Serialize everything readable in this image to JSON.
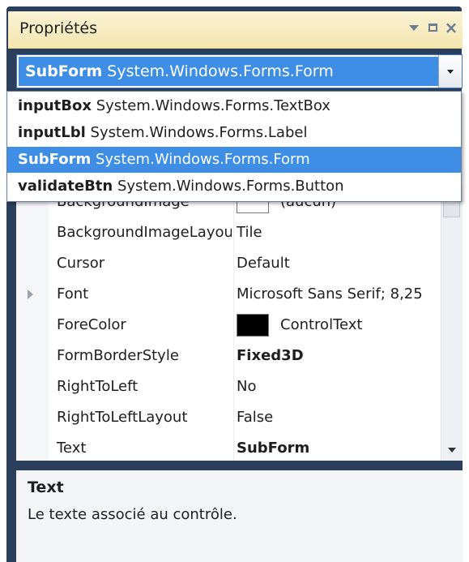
{
  "panel": {
    "title": "Propriétés",
    "icons": [
      "dropdown-triangle-icon",
      "maximize-icon",
      "close-icon"
    ]
  },
  "selector": {
    "name": "SubForm",
    "type": "System.Windows.Forms.Form"
  },
  "dropdown_items": [
    {
      "name": "inputBox",
      "type": "System.Windows.Forms.TextBox",
      "selected": false
    },
    {
      "name": "inputLbl",
      "type": "System.Windows.Forms.Label",
      "selected": false
    },
    {
      "name": "SubForm",
      "type": "System.Windows.Forms.Form",
      "selected": true
    },
    {
      "name": "validateBtn",
      "type": "System.Windows.Forms.Button",
      "selected": false
    }
  ],
  "properties": [
    {
      "name": "BackgroundImage",
      "value": "(aucun)"
    },
    {
      "name": "BackgroundImageLayout",
      "value": "Tile"
    },
    {
      "name": "Cursor",
      "value": "Default"
    },
    {
      "name": "Font",
      "value": "Microsoft Sans Serif; 8,25"
    },
    {
      "name": "ForeColor",
      "value": "ControlText"
    },
    {
      "name": "FormBorderStyle",
      "value": "Fixed3D"
    },
    {
      "name": "RightToLeft",
      "value": "No"
    },
    {
      "name": "RightToLeftLayout",
      "value": "False"
    },
    {
      "name": "Text",
      "value": "SubForm"
    }
  ],
  "description": {
    "title": "Text",
    "text": "Le texte associé au contrôle."
  },
  "colors": {
    "frame": "#2b3f5c",
    "selection": "#3e8ee6",
    "forecolor_swatch": "#000000"
  }
}
